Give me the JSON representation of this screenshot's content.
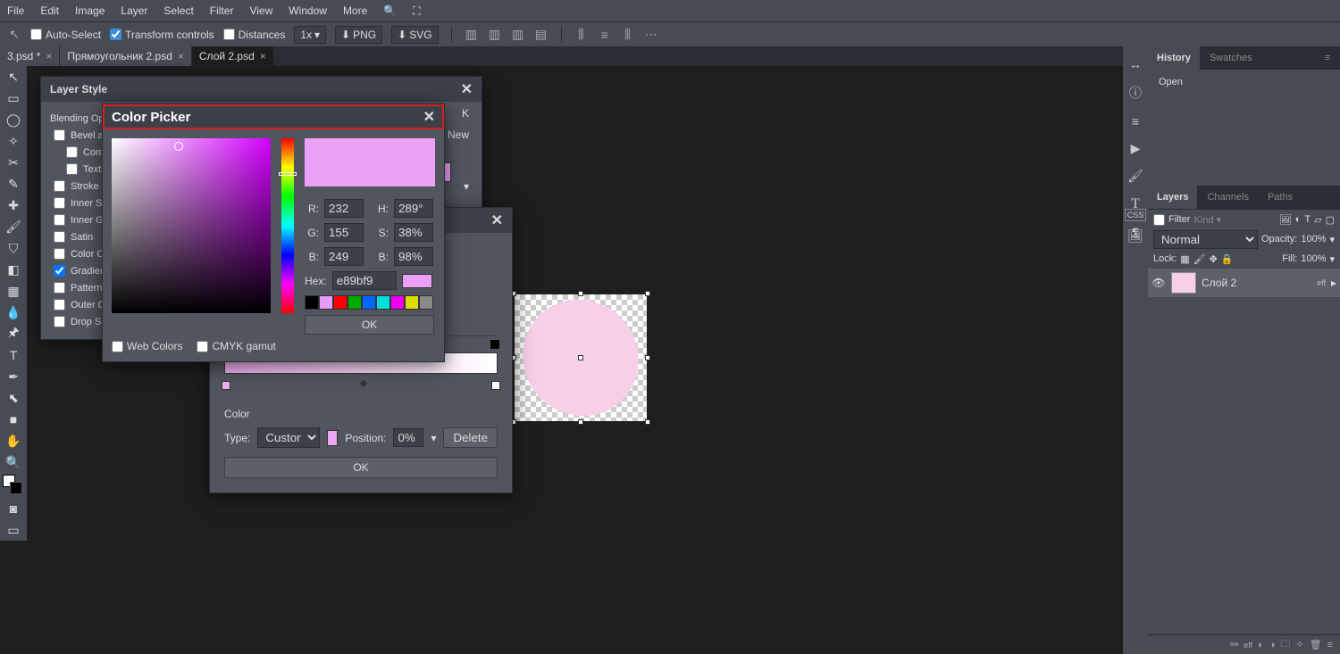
{
  "menu": {
    "file": "File",
    "edit": "Edit",
    "image": "Image",
    "layer": "Layer",
    "select": "Select",
    "filter": "Filter",
    "view": "View",
    "window": "Window",
    "more": "More"
  },
  "options": {
    "autoSelect": "Auto-Select",
    "transformControls": "Transform controls",
    "distances": "Distances",
    "zoom": "1x",
    "png": "PNG",
    "svg": "SVG"
  },
  "tabs": [
    "3.psd *",
    "Прямоугольник 2.psd",
    "Слой 2.psd"
  ],
  "layerStyle": {
    "title": "Layer Style",
    "blending": "Blending Opt",
    "fx": [
      "Bevel and",
      "Contou",
      "Texture",
      "Stroke",
      "Inner Sha",
      "Inner Glo",
      "Satin",
      "Color Ove",
      "Gradient",
      "Pattern O",
      "Outer Glo",
      "Drop Sha"
    ],
    "rightSnippet1": "K",
    "rightSnippet2": "e New"
  },
  "gradientEditor": {
    "colorLabel": "Color",
    "typeLabel": "Type:",
    "typeValue": "Custom",
    "posLabel": "Position:",
    "posValue": "0%",
    "delete": "Delete",
    "ok": "OK"
  },
  "colorPicker": {
    "title": "Color Picker",
    "r": "232",
    "g": "155",
    "b": "249",
    "h": "289°",
    "s": "38%",
    "br": "98%",
    "hexLabel": "Hex:",
    "hex": "e89bf9",
    "webColors": "Web Colors",
    "cmyk": "CMYK gamut",
    "ok": "OK",
    "palette": [
      "#000000",
      "#e89bf9",
      "#ff0000",
      "#00aa00",
      "#0066ff",
      "#00dddd",
      "#ee00ee",
      "#dddd00",
      "#888888"
    ]
  },
  "right": {
    "historyTab": "History",
    "swatchesTab": "Swatches",
    "open": "Open",
    "layersTab": "Layers",
    "channelsTab": "Channels",
    "pathsTab": "Paths",
    "filter": "Filter",
    "kind": "Kind",
    "normal": "Normal",
    "opacityLabel": "Opacity:",
    "opacity": "100%",
    "lockLabel": "Lock:",
    "fillLabel": "Fill:",
    "fill": "100%",
    "layerName": "Слой 2",
    "eff": "eff",
    "css": "CSS"
  }
}
